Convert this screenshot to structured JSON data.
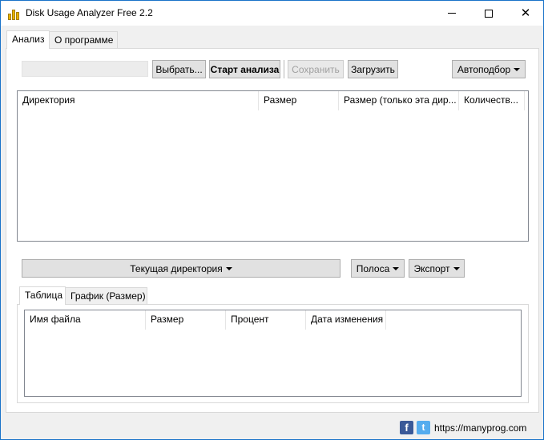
{
  "window": {
    "title": "Disk Usage Analyzer Free 2.2",
    "accent": "#1a73c9"
  },
  "titlebar": {
    "minimize_icon": "minimize-icon",
    "maximize_icon": "maximize-icon",
    "close_icon": "close-icon",
    "close_glyph": "✕"
  },
  "main_tabs": [
    {
      "label": "Анализ",
      "active": true
    },
    {
      "label": "О программе",
      "active": false
    }
  ],
  "toolbar": {
    "path_value": "",
    "browse_label": "Выбрать...",
    "start_label": "Старт анализа",
    "save_label": "Сохранить",
    "load_label": "Загрузить",
    "autofit_label": "Автоподбор"
  },
  "dir_table": {
    "columns": [
      "Директория",
      "Размер",
      "Размер (только эта дир...",
      "Количеств..."
    ],
    "rows": []
  },
  "middle_bar": {
    "current_dir_label": "Текущая директория",
    "bar_label": "Полоса",
    "export_label": "Экспорт"
  },
  "bottom_tabs": [
    {
      "label": "Таблица",
      "active": true
    },
    {
      "label": "График (Размер)",
      "active": false
    }
  ],
  "file_table": {
    "columns": [
      "Имя файла",
      "Размер",
      "Процент",
      "Дата изменения"
    ],
    "rows": []
  },
  "footer": {
    "facebook_glyph": "f",
    "twitter_glyph": "t",
    "link_text": "https://manyprog.com"
  }
}
